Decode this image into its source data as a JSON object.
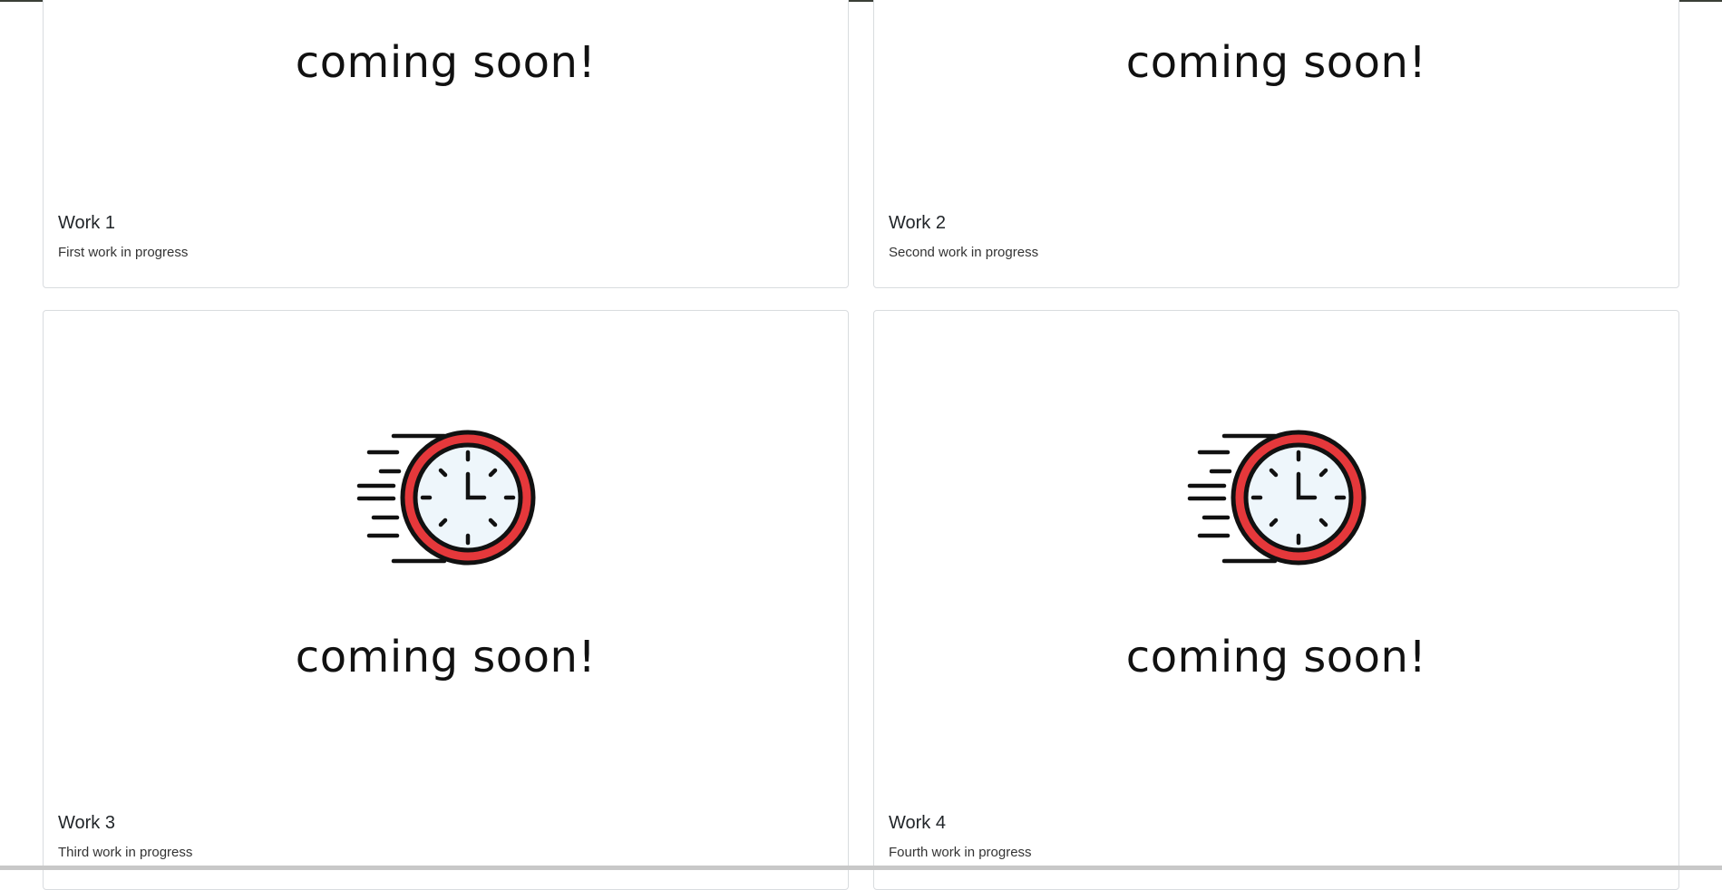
{
  "cards": [
    {
      "coming_text": "coming soon!",
      "title": "Work 1",
      "text": "First work in progress",
      "show_clock": false
    },
    {
      "coming_text": "coming soon!",
      "title": "Work 2",
      "text": "Second work in progress",
      "show_clock": false
    },
    {
      "coming_text": "coming soon!",
      "title": "Work 3",
      "text": "Third work in progress",
      "show_clock": true
    },
    {
      "coming_text": "coming soon!",
      "title": "Work 4",
      "text": "Fourth work in progress",
      "show_clock": true
    }
  ],
  "icon": {
    "name": "fast-clock-icon",
    "ring_color": "#e5383b",
    "face_color": "#eef6fb"
  }
}
